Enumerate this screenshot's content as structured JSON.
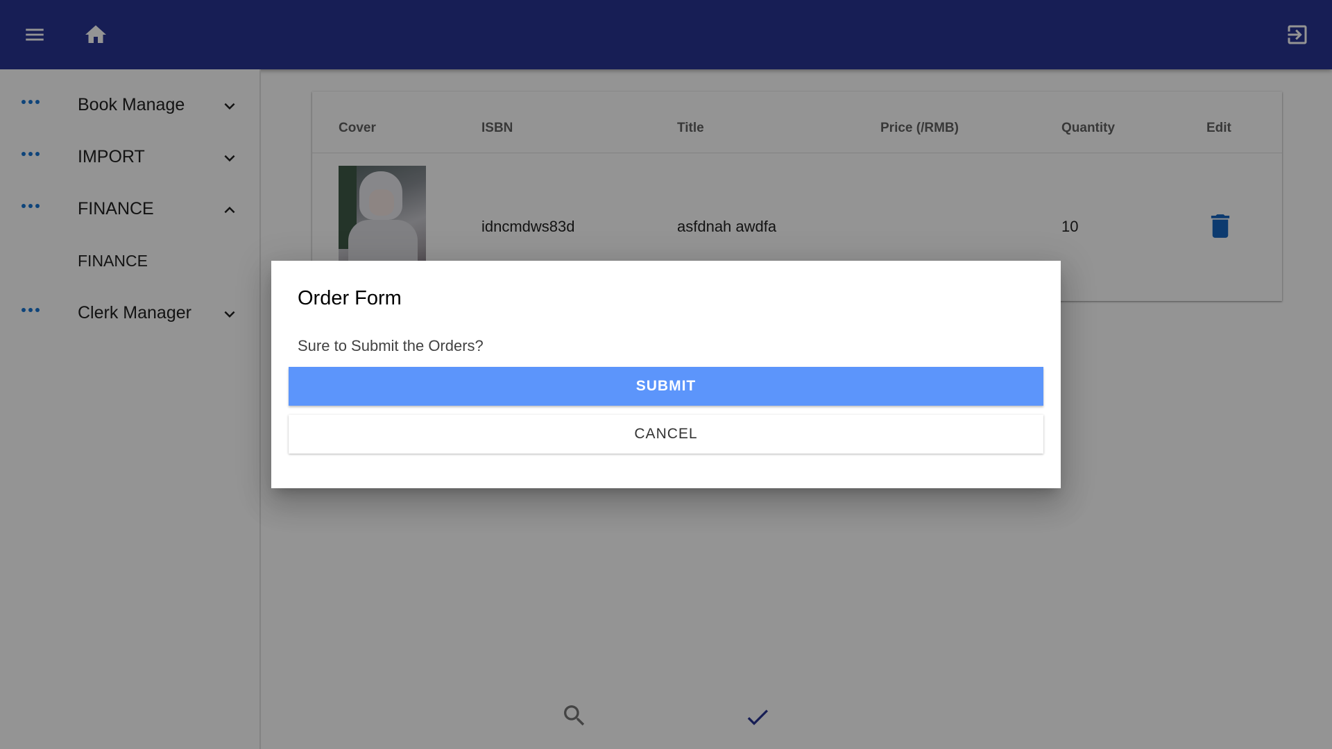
{
  "appbar": {
    "menu_icon": "menu-icon",
    "home_icon": "home-icon",
    "logout_icon": "exit-to-app-icon",
    "color": "#283593"
  },
  "sidebar": {
    "items": [
      {
        "label": "Book Manage",
        "expanded": false
      },
      {
        "label": "IMPORT",
        "expanded": false
      },
      {
        "label": "FINANCE",
        "expanded": true,
        "children": [
          {
            "label": "FINANCE"
          }
        ]
      },
      {
        "label": "Clerk Manager",
        "expanded": false
      }
    ],
    "accent": "#1976d2"
  },
  "table": {
    "headers": [
      "Cover",
      "ISBN",
      "Title",
      "Price (/RMB)",
      "Quantity",
      "Edit"
    ],
    "rows": [
      {
        "isbn": "idncmdws83d",
        "title": "asfdnah awdfa",
        "price": "",
        "quantity": "10",
        "edit_icon": "delete-icon"
      }
    ]
  },
  "bottom_actions": {
    "search_icon": "search-icon",
    "check_icon": "check-icon"
  },
  "dialog": {
    "title": "Order Form",
    "message": "Sure to Submit the Orders?",
    "submit_label": "SUBMIT",
    "cancel_label": "CANCEL",
    "submit_color": "#5c95fb"
  }
}
